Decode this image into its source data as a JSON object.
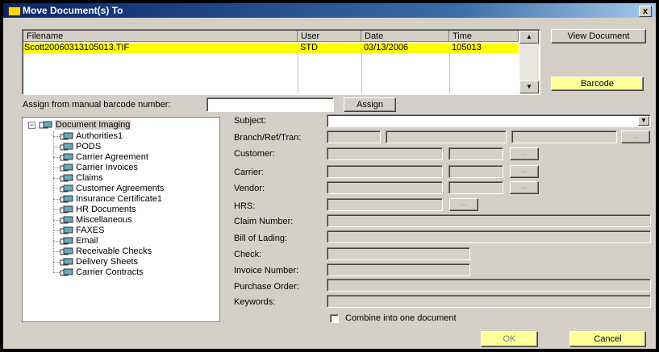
{
  "window": {
    "title": "Move Document(s) To",
    "close_label": "x"
  },
  "doclist": {
    "columns": [
      "Filename",
      "User",
      "Date",
      "Time"
    ],
    "rows": [
      {
        "filename": "Scott20060313105013.TIF",
        "user": "STD",
        "date": "03/13/2006",
        "time": "105013"
      }
    ]
  },
  "buttons": {
    "view_document": "View Document",
    "barcode": "Barcode",
    "assign": "Assign",
    "ok": "OK",
    "cancel": "Cancel"
  },
  "assign": {
    "label": "Assign from manual barcode number:",
    "value": ""
  },
  "tree": {
    "root": "Document Imaging",
    "items": [
      "Authorities1",
      "PODS",
      "Carrier Agreement",
      "Carrier Invoices",
      "Claims",
      "Customer Agreements",
      "Insurance Certificate1",
      "HR Documents",
      "Miscellaneous",
      "FAXES",
      "Email",
      "Receivable Checks",
      "Delivery Sheets",
      "Carrier Contracts"
    ]
  },
  "form": {
    "subject": "Subject:",
    "branch": "Branch/Ref/Tran:",
    "customer": "Customer:",
    "carrier": "Carrier:",
    "vendor": "Vendor:",
    "hrs": "HRS:",
    "claim_number": "Claim Number:",
    "bill_of_lading": "Bill of Lading:",
    "check": "Check:",
    "invoice_number": "Invoice Number:",
    "purchase_order": "Purchase Order:",
    "keywords": "Keywords:",
    "ellipsis": "...",
    "combine_label": "Combine into one document",
    "combine_checked": false
  },
  "colors": {
    "highlight": "#ffff00",
    "button_yellow": "#ffff99",
    "face": "#d4d0c8"
  }
}
